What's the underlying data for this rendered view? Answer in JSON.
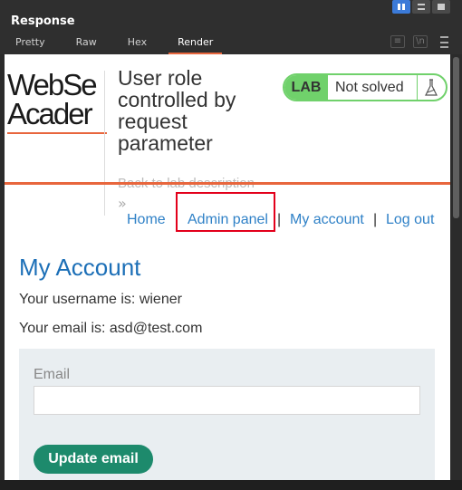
{
  "panel": {
    "title": "Response",
    "tabs": [
      "Pretty",
      "Raw",
      "Hex",
      "Render"
    ],
    "active_tab": "Render",
    "tool_icons": [
      "wrap-lines-icon",
      "newline-icon",
      "menu-icon"
    ]
  },
  "page": {
    "logo_line1": "WebSe",
    "logo_line2": "Acader",
    "lab_title": "User role controlled by request parameter",
    "back_link": "Back to lab description",
    "back_chevrons": "»",
    "lab_badge": "LAB",
    "lab_status": "Not solved",
    "nav": {
      "home": "Home",
      "admin_panel": "Admin panel",
      "sep": "|",
      "my_account": "My account",
      "log_out": "Log out"
    },
    "heading": "My Account",
    "username_line": "Your username is: wiener",
    "email_line": "Your email is: asd@test.com",
    "form": {
      "email_label": "Email",
      "email_value": "",
      "submit_label": "Update email"
    }
  },
  "colors": {
    "accent_orange": "#e8663d",
    "lab_green": "#70d16b",
    "link_blue": "#2f81c7",
    "heading_blue": "#1c6fb7",
    "button_green": "#1d8a6c",
    "highlight_red": "#e3001b"
  }
}
